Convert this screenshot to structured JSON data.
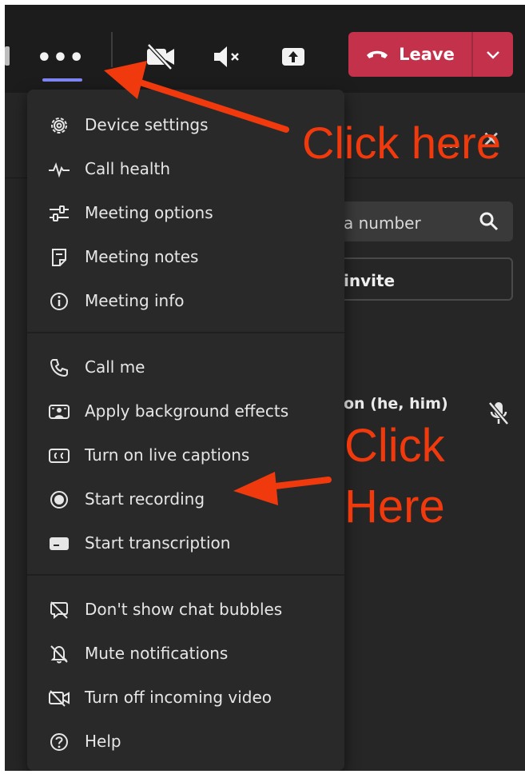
{
  "toolbar": {
    "more_label": "•••",
    "more_icon": "more-dots-icon",
    "camera_icon": "camera-off-icon",
    "mic_icon": "speaker-muted-icon",
    "share_icon": "share-tray-icon",
    "leave_label": "Leave",
    "leave_icon": "hang-up-phone-icon",
    "leave_caret_icon": "chevron-down-icon",
    "leave_color": "#c4314b",
    "active_underline_color": "#7f85f5"
  },
  "side_panel": {
    "more_label": "...",
    "close_label": "✕",
    "search_partial": "a number",
    "invite_partial": "invite",
    "participant_partial": "on (he, him)"
  },
  "menu": {
    "groups": [
      [
        {
          "label": "Device settings",
          "icon": "gear-icon"
        },
        {
          "label": "Call health",
          "icon": "pulse-icon"
        },
        {
          "label": "Meeting options",
          "icon": "sliders-icon"
        },
        {
          "label": "Meeting notes",
          "icon": "note-icon"
        },
        {
          "label": "Meeting info",
          "icon": "info-icon"
        }
      ],
      [
        {
          "label": "Call me",
          "icon": "phone-icon"
        },
        {
          "label": "Apply background effects",
          "icon": "background-effects-icon"
        },
        {
          "label": "Turn on live captions",
          "icon": "captions-icon"
        },
        {
          "label": "Start recording",
          "icon": "record-icon"
        },
        {
          "label": "Start transcription",
          "icon": "transcription-icon"
        }
      ],
      [
        {
          "label": "Don't show chat bubbles",
          "icon": "chat-bubble-off-icon"
        },
        {
          "label": "Mute notifications",
          "icon": "bell-off-icon"
        },
        {
          "label": "Turn off incoming video",
          "icon": "video-off-icon"
        },
        {
          "label": "Help",
          "icon": "help-icon"
        }
      ]
    ]
  },
  "annotations": {
    "top": "Click here",
    "middle_line1": "Click",
    "middle_line2": "Here",
    "color": "#f0390c"
  }
}
